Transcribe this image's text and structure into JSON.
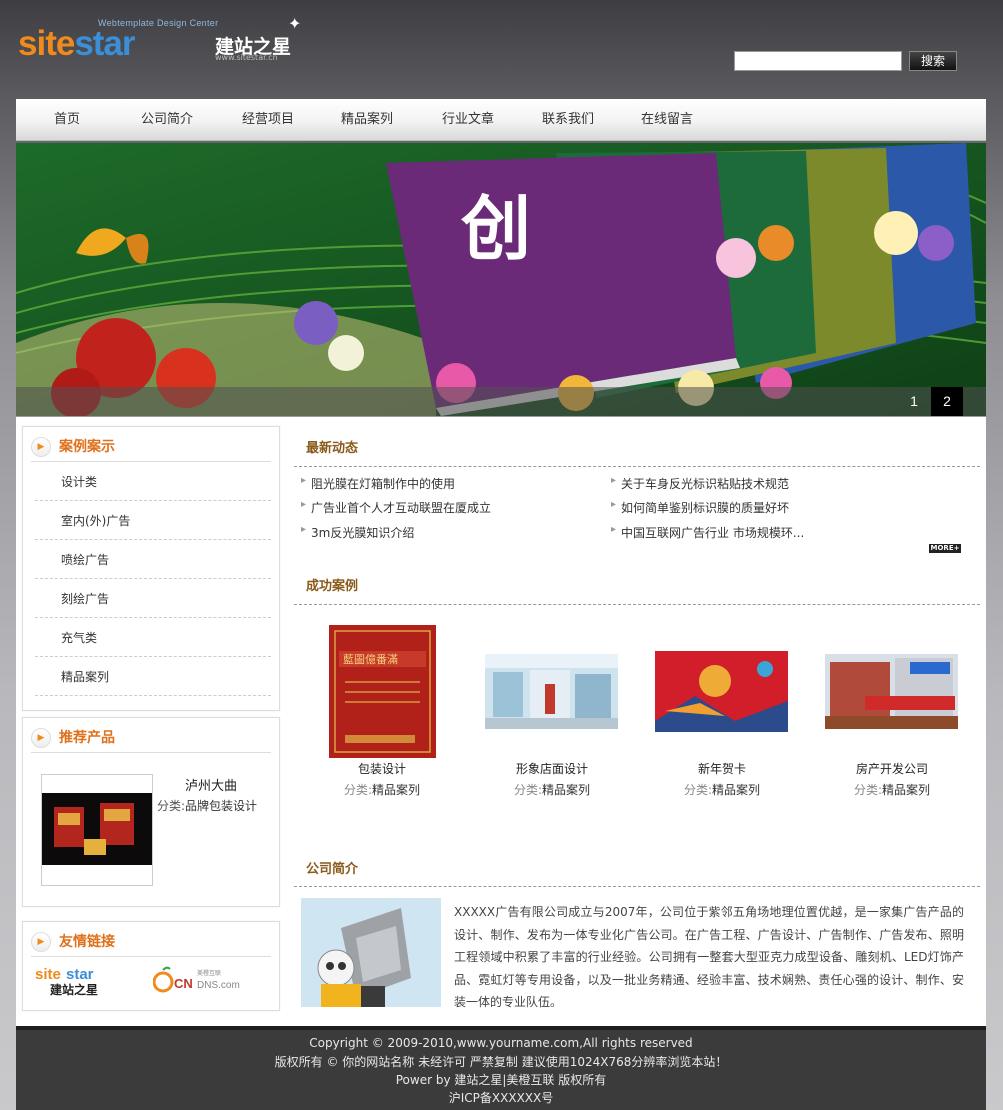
{
  "brand": {
    "tagline": "Webtemplate Design Center",
    "name_part1": "site",
    "name_part2": "star",
    "name_cn": "建站之星",
    "url": "www.sitestar.cn"
  },
  "search": {
    "placeholder": "",
    "button_label": "搜索"
  },
  "nav": [
    "首页",
    "公司简介",
    "经营项目",
    "精品案列",
    "行业文章",
    "联系我们",
    "在线留言"
  ],
  "banner": {
    "slides": [
      "1",
      "2"
    ],
    "active_slide": "2"
  },
  "sidebar": {
    "cases": {
      "title": "案例案示",
      "items": [
        "设计类",
        "室内(外)广告",
        "喷绘广告",
        "刻绘广告",
        "充气类",
        "精品案列"
      ]
    },
    "products": {
      "title": "推荐产品",
      "item": {
        "name": "泸州大曲",
        "category_label": "分类:",
        "category": "品牌包装设计"
      }
    },
    "links": {
      "title": "友情链接",
      "items": [
        "sitestar 建站之星",
        "美橙互联 CNDNS.com"
      ]
    }
  },
  "news": {
    "title": "最新动态",
    "items": [
      "阻光膜在灯箱制作中的使用",
      "关于车身反光标识粘贴技术规范",
      "广告业首个人才互动联盟在厦成立",
      "如何简单鉴别标识膜的质量好坏",
      "3m反光膜知识介绍",
      "中国互联网广告行业 市场规模环..."
    ],
    "more_label": "MORE+"
  },
  "cases": {
    "title": "成功案例",
    "category_label": "分类:",
    "items": [
      {
        "name": "包装设计",
        "category": "精品案列"
      },
      {
        "name": "形象店面设计",
        "category": "精品案列"
      },
      {
        "name": "新年贺卡",
        "category": "精品案列"
      },
      {
        "name": "房产开发公司",
        "category": "精品案列"
      }
    ]
  },
  "about": {
    "title": "公司简介",
    "text": "XXXXX广告有限公司成立与2007年，公司位于紫邻五角场地理位置优越，是一家集广告产品的设计、制作、发布为一体专业化广告公司。在广告工程、广告设计、广告制作、广告发布、照明工程领域中积累了丰富的行业经验。公司拥有一整套大型亚克力成型设备、雕刻机、LED灯饰产品、霓虹灯等专用设备，以及一批业务精通、经验丰富、技术娴熟、责任心强的设计、制作、安装一体的专业队伍。"
  },
  "footer": {
    "line1": "Copyright © 2009-2010,www.yourname.com,All rights reserved",
    "line2": "版权所有 © 你的网站名称  未经许可  严禁复制  建议使用1024X768分辨率浏览本站！",
    "line3": "Power by 建站之星|美橙互联 版权所有",
    "line4": "沪ICP备XXXXXX号"
  }
}
